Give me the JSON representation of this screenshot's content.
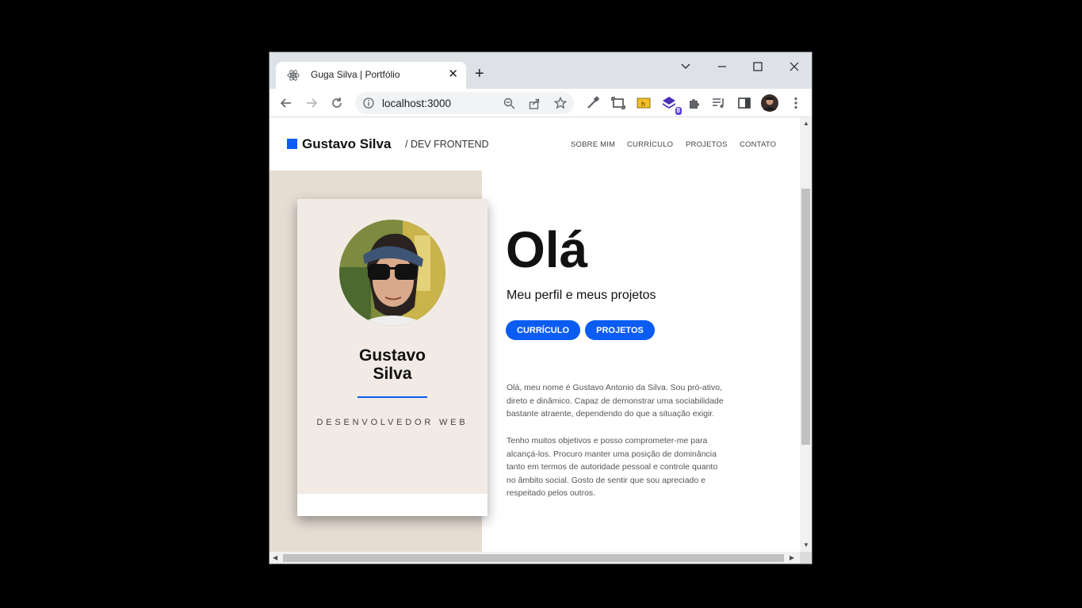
{
  "browser": {
    "tab_title": "Guga Silva | Portfólio",
    "url": "localhost:3000",
    "extension_badge": "8"
  },
  "site": {
    "brand_name": "Gustavo Silva",
    "brand_sub": "/ DEV FRONTEND",
    "nav": [
      "SOBRE MIM",
      "CURRÍCULO",
      "PROJETOS",
      "CONTATO"
    ],
    "card": {
      "name_line1": "Gustavo",
      "name_line2": "Silva",
      "role": "DESENVOLVEDOR WEB"
    },
    "hero": {
      "title": "Olá",
      "subtitle": "Meu perfil e meus projetos",
      "btn_curriculo": "CURRÍCULO",
      "btn_projetos": "PROJETOS"
    },
    "about": {
      "p1_lines": [
        "Olá, meu nome é Gustavo Antonio da Silva. Sou pró-ativo,",
        "direto e dinâmico. Capaz de demonstrar uma sociabilidade",
        "bastante atraente, dependendo do que a situação exigir."
      ],
      "p2_lines": [
        "Tenho muitos objetivos e posso comprometer-me para",
        "alcançá-los. Procuro manter uma posição de dominância",
        "tanto em termos de autoridade pessoal e controle quanto",
        "no âmbito social. Gosto de sentir que sou apreciado e",
        "respeitado pelos outros."
      ]
    }
  },
  "colors": {
    "accent": "#0b5cf1",
    "beige": "#e5dcd2",
    "card": "#f2ebe5"
  }
}
